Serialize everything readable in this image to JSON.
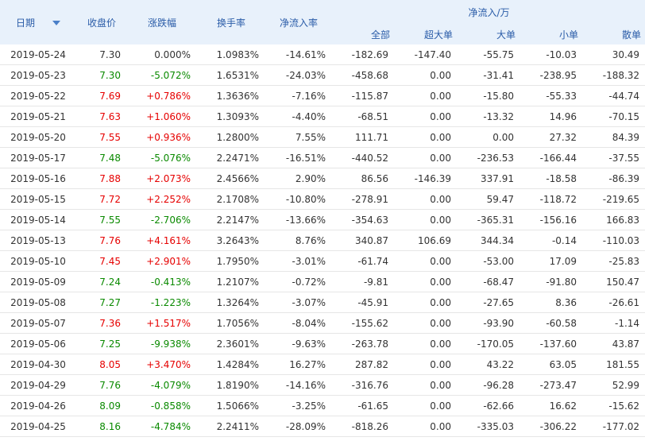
{
  "headers": {
    "date": "日期",
    "close": "收盘价",
    "change": "涨跌幅",
    "turnover": "换手率",
    "net_inflow_rate": "净流入率",
    "net_inflow_group": "净流入/万",
    "sub": [
      "全部",
      "超大单",
      "大单",
      "小单",
      "散单"
    ]
  },
  "rows": [
    {
      "date": "2019-05-24",
      "close": "7.30",
      "change": "0.000%",
      "turnover": "1.0983%",
      "rate": "-14.61%",
      "all": "-182.69",
      "xl": "-147.40",
      "l": "-55.75",
      "s": "-10.03",
      "r": "30.49",
      "dir": "flat"
    },
    {
      "date": "2019-05-23",
      "close": "7.30",
      "change": "-5.072%",
      "turnover": "1.6531%",
      "rate": "-24.03%",
      "all": "-458.68",
      "xl": "0.00",
      "l": "-31.41",
      "s": "-238.95",
      "r": "-188.32",
      "dir": "neg"
    },
    {
      "date": "2019-05-22",
      "close": "7.69",
      "change": "+0.786%",
      "turnover": "1.3636%",
      "rate": "-7.16%",
      "all": "-115.87",
      "xl": "0.00",
      "l": "-15.80",
      "s": "-55.33",
      "r": "-44.74",
      "dir": "pos"
    },
    {
      "date": "2019-05-21",
      "close": "7.63",
      "change": "+1.060%",
      "turnover": "1.3093%",
      "rate": "-4.40%",
      "all": "-68.51",
      "xl": "0.00",
      "l": "-13.32",
      "s": "14.96",
      "r": "-70.15",
      "dir": "pos"
    },
    {
      "date": "2019-05-20",
      "close": "7.55",
      "change": "+0.936%",
      "turnover": "1.2800%",
      "rate": "7.55%",
      "all": "111.71",
      "xl": "0.00",
      "l": "0.00",
      "s": "27.32",
      "r": "84.39",
      "dir": "pos"
    },
    {
      "date": "2019-05-17",
      "close": "7.48",
      "change": "-5.076%",
      "turnover": "2.2471%",
      "rate": "-16.51%",
      "all": "-440.52",
      "xl": "0.00",
      "l": "-236.53",
      "s": "-166.44",
      "r": "-37.55",
      "dir": "neg"
    },
    {
      "date": "2019-05-16",
      "close": "7.88",
      "change": "+2.073%",
      "turnover": "2.4566%",
      "rate": "2.90%",
      "all": "86.56",
      "xl": "-146.39",
      "l": "337.91",
      "s": "-18.58",
      "r": "-86.39",
      "dir": "pos"
    },
    {
      "date": "2019-05-15",
      "close": "7.72",
      "change": "+2.252%",
      "turnover": "2.1708%",
      "rate": "-10.80%",
      "all": "-278.91",
      "xl": "0.00",
      "l": "59.47",
      "s": "-118.72",
      "r": "-219.65",
      "dir": "pos"
    },
    {
      "date": "2019-05-14",
      "close": "7.55",
      "change": "-2.706%",
      "turnover": "2.2147%",
      "rate": "-13.66%",
      "all": "-354.63",
      "xl": "0.00",
      "l": "-365.31",
      "s": "-156.16",
      "r": "166.83",
      "dir": "neg"
    },
    {
      "date": "2019-05-13",
      "close": "7.76",
      "change": "+4.161%",
      "turnover": "3.2643%",
      "rate": "8.76%",
      "all": "340.87",
      "xl": "106.69",
      "l": "344.34",
      "s": "-0.14",
      "r": "-110.03",
      "dir": "pos"
    },
    {
      "date": "2019-05-10",
      "close": "7.45",
      "change": "+2.901%",
      "turnover": "1.7950%",
      "rate": "-3.01%",
      "all": "-61.74",
      "xl": "0.00",
      "l": "-53.00",
      "s": "17.09",
      "r": "-25.83",
      "dir": "pos"
    },
    {
      "date": "2019-05-09",
      "close": "7.24",
      "change": "-0.413%",
      "turnover": "1.2107%",
      "rate": "-0.72%",
      "all": "-9.81",
      "xl": "0.00",
      "l": "-68.47",
      "s": "-91.80",
      "r": "150.47",
      "dir": "neg"
    },
    {
      "date": "2019-05-08",
      "close": "7.27",
      "change": "-1.223%",
      "turnover": "1.3264%",
      "rate": "-3.07%",
      "all": "-45.91",
      "xl": "0.00",
      "l": "-27.65",
      "s": "8.36",
      "r": "-26.61",
      "dir": "neg"
    },
    {
      "date": "2019-05-07",
      "close": "7.36",
      "change": "+1.517%",
      "turnover": "1.7056%",
      "rate": "-8.04%",
      "all": "-155.62",
      "xl": "0.00",
      "l": "-93.90",
      "s": "-60.58",
      "r": "-1.14",
      "dir": "pos"
    },
    {
      "date": "2019-05-06",
      "close": "7.25",
      "change": "-9.938%",
      "turnover": "2.3601%",
      "rate": "-9.63%",
      "all": "-263.78",
      "xl": "0.00",
      "l": "-170.05",
      "s": "-137.60",
      "r": "43.87",
      "dir": "neg"
    },
    {
      "date": "2019-04-30",
      "close": "8.05",
      "change": "+3.470%",
      "turnover": "1.4284%",
      "rate": "16.27%",
      "all": "287.82",
      "xl": "0.00",
      "l": "43.22",
      "s": "63.05",
      "r": "181.55",
      "dir": "pos"
    },
    {
      "date": "2019-04-29",
      "close": "7.76",
      "change": "-4.079%",
      "turnover": "1.8190%",
      "rate": "-14.16%",
      "all": "-316.76",
      "xl": "0.00",
      "l": "-96.28",
      "s": "-273.47",
      "r": "52.99",
      "dir": "neg"
    },
    {
      "date": "2019-04-26",
      "close": "8.09",
      "change": "-0.858%",
      "turnover": "1.5066%",
      "rate": "-3.25%",
      "all": "-61.65",
      "xl": "0.00",
      "l": "-62.66",
      "s": "16.62",
      "r": "-15.62",
      "dir": "neg"
    },
    {
      "date": "2019-04-25",
      "close": "8.16",
      "change": "-4.784%",
      "turnover": "2.2411%",
      "rate": "-28.09%",
      "all": "-818.26",
      "xl": "0.00",
      "l": "-335.03",
      "s": "-306.22",
      "r": "-177.02",
      "dir": "neg"
    }
  ]
}
